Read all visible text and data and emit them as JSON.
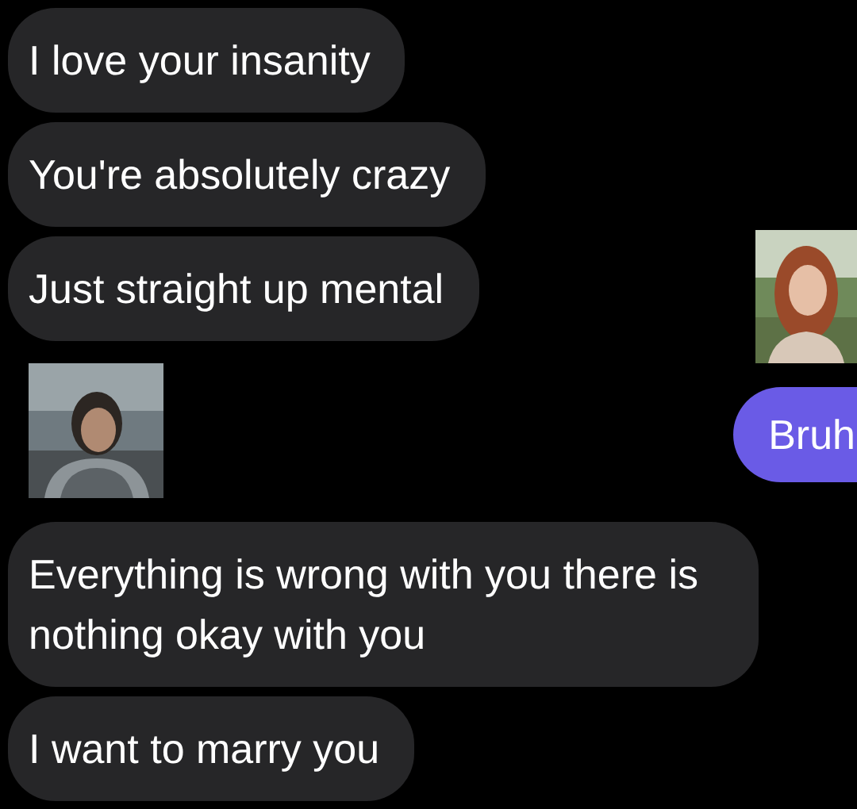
{
  "messages": [
    {
      "kind": "text",
      "outgoing": false,
      "text": "I love your insanity"
    },
    {
      "kind": "text",
      "outgoing": false,
      "text": "You're absolutely crazy"
    },
    {
      "kind": "text",
      "outgoing": false,
      "text": "Just straight up mental"
    },
    {
      "kind": "picture",
      "outgoing": true
    },
    {
      "kind": "picture",
      "outgoing": false
    },
    {
      "kind": "text",
      "outgoing": true,
      "text": "Bruh"
    },
    {
      "kind": "text",
      "outgoing": false,
      "text": "Everything is wrong with you there is nothing okay with you"
    },
    {
      "kind": "text",
      "outgoing": false,
      "text": "I want to marry you"
    }
  ]
}
